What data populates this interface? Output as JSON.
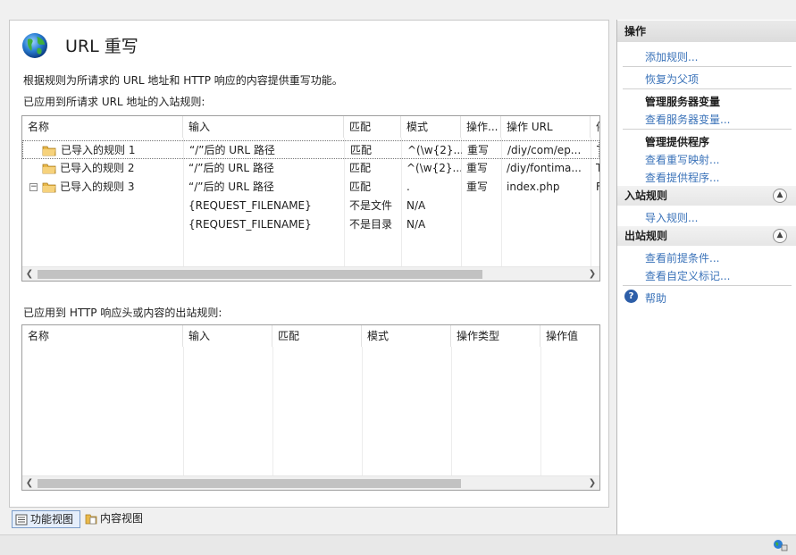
{
  "page": {
    "title": "URL 重写",
    "description": "根据规则为所请求的 URL 地址和 HTTP 响应的内容提供重写功能。",
    "inbound_label": "已应用到所请求 URL 地址的入站规则:",
    "outbound_label": "已应用到 HTTP 响应头或内容的出站规则:"
  },
  "inbound_table": {
    "columns": [
      "名称",
      "输入",
      "匹配",
      "模式",
      "操作...",
      "操作 URL",
      "停"
    ],
    "rows": [
      {
        "name": "已导入的规则 1",
        "input": "“/”后的 URL 路径",
        "match": "匹配",
        "pattern": "^(\\w{2}...",
        "action": "重写",
        "url": "/diy/com/ep...",
        "stop": "T",
        "expander": ""
      },
      {
        "name": "已导入的规则 2",
        "input": "“/”后的 URL 路径",
        "match": "匹配",
        "pattern": "^(\\w{2}...",
        "action": "重写",
        "url": "/diy/fontima...",
        "stop": "T",
        "expander": ""
      },
      {
        "name": "已导入的规则 3",
        "input": "“/”后的 URL 路径",
        "match": "匹配",
        "pattern": ".",
        "action": "重写",
        "url": "index.php",
        "stop": "F",
        "expander": "−"
      }
    ],
    "conditions": [
      {
        "input": "{REQUEST_FILENAME}",
        "match": "不是文件",
        "pattern": "N/A"
      },
      {
        "input": "{REQUEST_FILENAME}",
        "match": "不是目录",
        "pattern": "N/A"
      }
    ]
  },
  "outbound_table": {
    "columns": [
      "名称",
      "输入",
      "匹配",
      "模式",
      "操作类型",
      "操作值"
    ]
  },
  "views": {
    "features": "功能视图",
    "content": "内容视图"
  },
  "actions": {
    "header": "操作",
    "add_rule": "添加规则...",
    "revert_parent": "恢复为父项",
    "server_vars_group": "管理服务器变量",
    "view_server_vars": "查看服务器变量...",
    "providers_group": "管理提供程序",
    "view_rewrite_maps": "查看重写映射...",
    "view_providers": "查看提供程序...",
    "inbound_section": "入站规则",
    "import_rules": "导入规则...",
    "outbound_section": "出站规则",
    "view_preconditions": "查看前提条件...",
    "view_custom_tags": "查看自定义标记...",
    "help": "帮助"
  },
  "colors": {
    "link": "#3b73b9",
    "folder": "#e9b84a",
    "accent": "#2d5ea8"
  }
}
